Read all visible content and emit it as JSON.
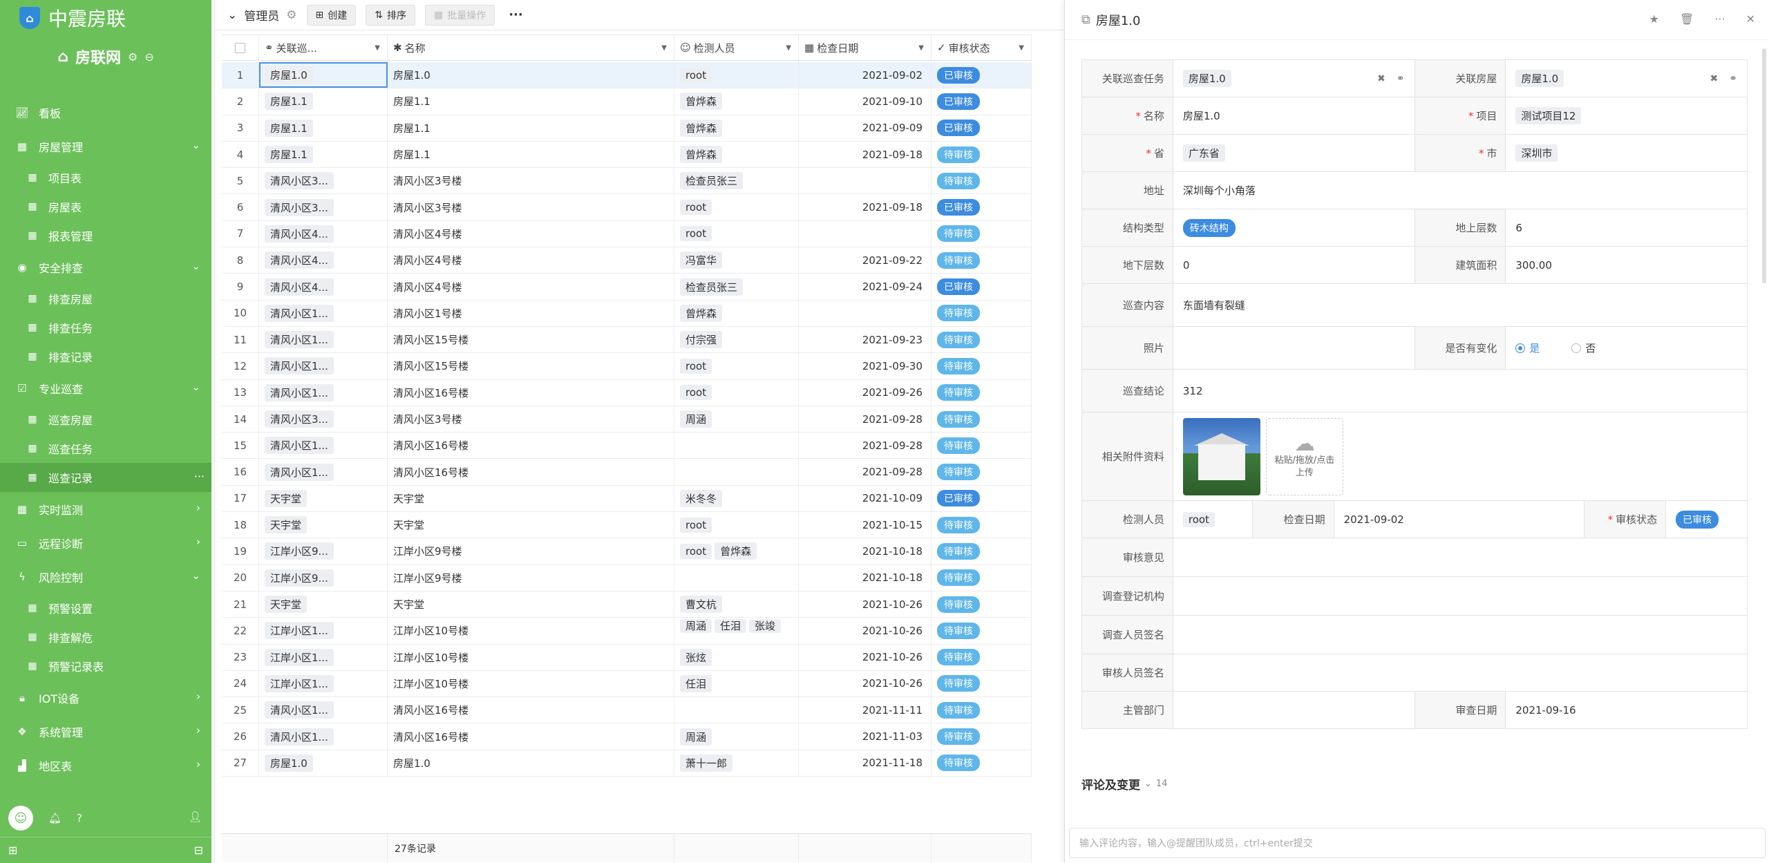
{
  "sidebar": {
    "brand": "中震房联",
    "org": "房联网",
    "nav": [
      {
        "label": "看板",
        "icon": "chart-line-icon",
        "type": "item"
      },
      {
        "label": "房屋管理",
        "icon": "calendar-icon",
        "type": "group",
        "open": true
      },
      {
        "label": "项目表",
        "icon": "table-icon",
        "type": "sub"
      },
      {
        "label": "房屋表",
        "icon": "table-icon",
        "type": "sub"
      },
      {
        "label": "报表管理",
        "icon": "table-icon",
        "type": "sub"
      },
      {
        "label": "安全排查",
        "icon": "eye-icon",
        "type": "group",
        "open": true
      },
      {
        "label": "排查房屋",
        "icon": "table-icon",
        "type": "sub"
      },
      {
        "label": "排查任务",
        "icon": "table-icon",
        "type": "sub"
      },
      {
        "label": "排查记录",
        "icon": "table-icon",
        "type": "sub"
      },
      {
        "label": "专业巡查",
        "icon": "check-calendar-icon",
        "type": "group",
        "open": true
      },
      {
        "label": "巡查房屋",
        "icon": "table-icon",
        "type": "sub"
      },
      {
        "label": "巡查任务",
        "icon": "table-icon",
        "type": "sub"
      },
      {
        "label": "巡查记录",
        "icon": "table-icon",
        "type": "sub",
        "active": true
      },
      {
        "label": "实时监测",
        "icon": "calendar-icon",
        "type": "group",
        "open": false
      },
      {
        "label": "远程诊断",
        "icon": "monitor-icon",
        "type": "group",
        "open": false
      },
      {
        "label": "风险控制",
        "icon": "bolt-icon",
        "type": "group",
        "open": true
      },
      {
        "label": "预警设置",
        "icon": "table-icon",
        "type": "sub"
      },
      {
        "label": "排查解危",
        "icon": "table-icon",
        "type": "sub"
      },
      {
        "label": "预警记录表",
        "icon": "table-icon",
        "type": "sub"
      },
      {
        "label": "IOT设备",
        "icon": "lock-icon",
        "type": "group",
        "open": false
      },
      {
        "label": "系统管理",
        "icon": "cubes-icon",
        "type": "group",
        "open": false
      },
      {
        "label": "地区表",
        "icon": "area-chart-icon",
        "type": "group",
        "open": false
      }
    ]
  },
  "toolbar": {
    "title": "管理员",
    "create": "创建",
    "sort": "排序",
    "batch": "批量操作"
  },
  "table": {
    "columns": [
      "关联巡...",
      "名称",
      "检测人员",
      "检查日期",
      "审核状态"
    ],
    "rows": [
      {
        "n": "1",
        "link": "房屋1.0",
        "name": "房屋1.0",
        "people": [
          "root"
        ],
        "date": "2021-09-02",
        "status": "已审核"
      },
      {
        "n": "2",
        "link": "房屋1.1",
        "name": "房屋1.1",
        "people": [
          "曾烨森"
        ],
        "date": "2021-09-10",
        "status": "已审核"
      },
      {
        "n": "3",
        "link": "房屋1.1",
        "name": "房屋1.1",
        "people": [
          "曾烨森"
        ],
        "date": "2021-09-09",
        "status": "已审核"
      },
      {
        "n": "4",
        "link": "房屋1.1",
        "name": "房屋1.1",
        "people": [
          "曾烨森"
        ],
        "date": "2021-09-18",
        "status": "待审核"
      },
      {
        "n": "5",
        "link": "清风小区3...",
        "name": "清风小区3号楼",
        "people": [
          "检查员张三"
        ],
        "date": "",
        "status": "待审核"
      },
      {
        "n": "6",
        "link": "清风小区3...",
        "name": "清风小区3号楼",
        "people": [
          "root"
        ],
        "date": "2021-09-18",
        "status": "已审核"
      },
      {
        "n": "7",
        "link": "清风小区4...",
        "name": "清风小区4号楼",
        "people": [
          "root"
        ],
        "date": "",
        "status": "待审核"
      },
      {
        "n": "8",
        "link": "清风小区4...",
        "name": "清风小区4号楼",
        "people": [
          "冯富华"
        ],
        "date": "2021-09-22",
        "status": "待审核"
      },
      {
        "n": "9",
        "link": "清风小区4...",
        "name": "清风小区4号楼",
        "people": [
          "检查员张三"
        ],
        "date": "2021-09-24",
        "status": "已审核"
      },
      {
        "n": "10",
        "link": "清风小区1...",
        "name": "清风小区1号楼",
        "people": [
          "曾烨森"
        ],
        "date": "",
        "status": "待审核"
      },
      {
        "n": "11",
        "link": "清风小区1...",
        "name": "清风小区15号楼",
        "people": [
          "付宗强"
        ],
        "date": "2021-09-23",
        "status": "待审核"
      },
      {
        "n": "12",
        "link": "清风小区1...",
        "name": "清风小区15号楼",
        "people": [
          "root"
        ],
        "date": "2021-09-30",
        "status": "待审核"
      },
      {
        "n": "13",
        "link": "清风小区1...",
        "name": "清风小区16号楼",
        "people": [
          "root"
        ],
        "date": "2021-09-26",
        "status": "待审核"
      },
      {
        "n": "14",
        "link": "清风小区3...",
        "name": "清风小区3号楼",
        "people": [
          "周涵"
        ],
        "date": "2021-09-28",
        "status": "待审核"
      },
      {
        "n": "15",
        "link": "清风小区1...",
        "name": "清风小区16号楼",
        "people": [],
        "date": "2021-09-28",
        "status": "待审核"
      },
      {
        "n": "16",
        "link": "清风小区1...",
        "name": "清风小区16号楼",
        "people": [],
        "date": "2021-09-28",
        "status": "待审核"
      },
      {
        "n": "17",
        "link": "天宇堂",
        "name": "天宇堂",
        "people": [
          "米冬冬"
        ],
        "date": "2021-10-09",
        "status": "已审核"
      },
      {
        "n": "18",
        "link": "天宇堂",
        "name": "天宇堂",
        "people": [
          "root"
        ],
        "date": "2021-10-15",
        "status": "待审核"
      },
      {
        "n": "19",
        "link": "江岸小区9...",
        "name": "江岸小区9号楼",
        "people": [
          "root",
          "曾烨森"
        ],
        "date": "2021-10-18",
        "status": "待审核"
      },
      {
        "n": "20",
        "link": "江岸小区9...",
        "name": "江岸小区9号楼",
        "people": [],
        "date": "2021-10-18",
        "status": "待审核"
      },
      {
        "n": "21",
        "link": "天宇堂",
        "name": "天宇堂",
        "people": [
          "曹文杭"
        ],
        "date": "2021-10-26",
        "status": "待审核"
      },
      {
        "n": "22",
        "link": "江岸小区1...",
        "name": "江岸小区10号楼",
        "people": [
          "周涵",
          "任泪",
          "张竣"
        ],
        "date": "2021-10-26",
        "status": "待审核"
      },
      {
        "n": "23",
        "link": "江岸小区1...",
        "name": "江岸小区10号楼",
        "people": [
          "张炫"
        ],
        "date": "2021-10-26",
        "status": "待审核"
      },
      {
        "n": "24",
        "link": "江岸小区1...",
        "name": "江岸小区10号楼",
        "people": [
          "任泪"
        ],
        "date": "2021-10-26",
        "status": "待审核"
      },
      {
        "n": "25",
        "link": "清风小区1...",
        "name": "清风小区16号楼",
        "people": [],
        "date": "2021-11-11",
        "status": "待审核"
      },
      {
        "n": "26",
        "link": "清风小区1...",
        "name": "清风小区16号楼",
        "people": [
          "周涵"
        ],
        "date": "2021-11-03",
        "status": "待审核"
      },
      {
        "n": "27",
        "link": "房屋1.0",
        "name": "房屋1.0",
        "people": [
          "萧十一郎"
        ],
        "date": "2021-11-18",
        "status": "待审核"
      }
    ],
    "footer_count": "27条记录"
  },
  "detail": {
    "title": "房屋1.0",
    "fields": {
      "task_label": "关联巡查任务",
      "task_value": "房屋1.0",
      "house_label": "关联房屋",
      "house_value": "房屋1.0",
      "name_label": "名称",
      "name_value": "房屋1.0",
      "project_label": "项目",
      "project_value": "测试项目12",
      "province_label": "省",
      "province_value": "广东省",
      "city_label": "市",
      "city_value": "深圳市",
      "address_label": "地址",
      "address_value": "深圳每个小角落",
      "structure_label": "结构类型",
      "structure_value": "砖木结构",
      "floors_above_label": "地上层数",
      "floors_above_value": "6",
      "floors_below_label": "地下层数",
      "floors_below_value": "0",
      "area_label": "建筑面积",
      "area_value": "300.00",
      "content_label": "巡查内容",
      "content_value": "东面墙有裂缝",
      "photo_label": "照片",
      "changed_label": "是否有变化",
      "changed_yes": "是",
      "changed_no": "否",
      "conclusion_label": "巡查结论",
      "conclusion_value": "312",
      "attachment_label": "相关附件资料",
      "upload_text": "粘贴/拖放/点击上传",
      "inspector_label": "检测人员",
      "inspector_value": "root",
      "check_date_label": "检查日期",
      "check_date_value": "2021-09-02",
      "review_status_label": "审核状态",
      "review_status_value": "已审核",
      "opinion_label": "审核意见",
      "agency_label": "调查登记机构",
      "investigator_sign_label": "调查人员签名",
      "reviewer_sign_label": "审核人员签名",
      "department_label": "主管部门",
      "review_date_label": "审查日期",
      "review_date_value": "2021-09-16"
    },
    "comments_title": "评论及变更",
    "comments_count": "14",
    "comment_placeholder": "输入评论内容，输入@提醒团队成员，ctrl+enter提交"
  },
  "colors": {
    "sidebar": "#6cc05a",
    "approved": "#3c8ce0",
    "pending": "#5fb6e9"
  }
}
